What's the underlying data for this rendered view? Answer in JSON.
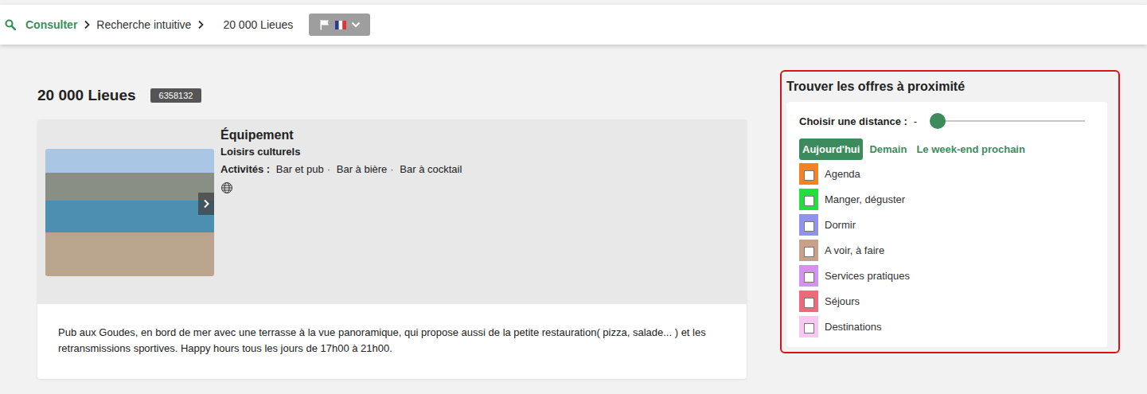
{
  "breadcrumb": {
    "items": [
      {
        "label": "Consulter",
        "link": true
      },
      {
        "label": "Recherche intuitive",
        "link": false
      },
      {
        "label": "20 000 Lieues",
        "link": false
      }
    ]
  },
  "offer": {
    "title": "20 000 Lieues",
    "id": "6358132",
    "category": "Équipement",
    "subcategory": "Loisirs culturels",
    "activities_label": "Activités :",
    "activities": [
      "Bar et pub",
      "Bar à bière",
      "Bar à cocktail"
    ],
    "activities_separator": "·",
    "description": "Pub aux Goudes, en bord de mer avec une terrasse à la vue panoramique, qui propose aussi de la petite restauration( pizza, salade... ) et les retransmissions sportives. Happy hours tous les jours de 17h00 à 21h00."
  },
  "nearby": {
    "title": "Trouver les offres à proximité",
    "distance_label": "Choisir une distance :",
    "distance_reading": "-",
    "level": 0,
    "periods": [
      {
        "label": "Aujourd'hui",
        "selected": true
      },
      {
        "label": "Demain",
        "selected": false
      },
      {
        "label": "Le week-end prochain",
        "selected": false
      }
    ],
    "categories": [
      {
        "label": "Agenda",
        "checked": false,
        "color": "#f5821f"
      },
      {
        "label": "Manger, déguster",
        "checked": false,
        "color": "#22e03a"
      },
      {
        "label": "Dormir",
        "checked": false,
        "color": "#8f92f0"
      },
      {
        "label": "A voir, à faire",
        "checked": false,
        "color": "#c9a08a"
      },
      {
        "label": "Services pratiques",
        "checked": false,
        "color": "#d490f2"
      },
      {
        "label": "Séjours",
        "checked": false,
        "color": "#f0687a"
      },
      {
        "label": "Destinations",
        "checked": false,
        "color": "#f8c8f2"
      }
    ]
  }
}
